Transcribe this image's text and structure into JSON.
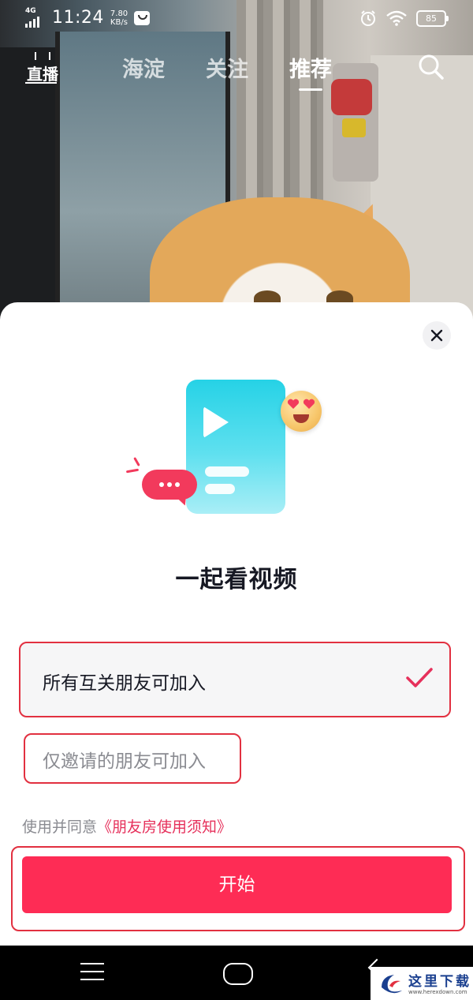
{
  "status_bar": {
    "network": "4G",
    "time": "11:24",
    "speed_value": "7.80",
    "speed_unit": "KB/s",
    "battery": "85",
    "icons": [
      "signal-icon",
      "notification-icon",
      "alarm-icon",
      "wifi-icon",
      "battery-icon"
    ]
  },
  "top_nav": {
    "live_label": "直播",
    "tabs": [
      {
        "label": "海淀",
        "active": false
      },
      {
        "label": "关注",
        "active": false
      },
      {
        "label": "推荐",
        "active": true
      }
    ],
    "search_icon": "search-icon"
  },
  "sheet": {
    "close_icon": "close-icon",
    "title": "一起看视频",
    "options": [
      {
        "label": "所有互关朋友可加入",
        "selected": true
      },
      {
        "label": "仅邀请的朋友可加入",
        "selected": false
      }
    ],
    "agreement_prefix": "使用并同意",
    "agreement_link": "《朋友房使用须知》",
    "start_button": "开始"
  },
  "colors": {
    "accent": "#fe2c55",
    "highlight_border": "#e23040",
    "illustration_cyan": "#26d2e6"
  },
  "watermark": {
    "text": "这里下载",
    "url": "www.herexdown.com"
  }
}
